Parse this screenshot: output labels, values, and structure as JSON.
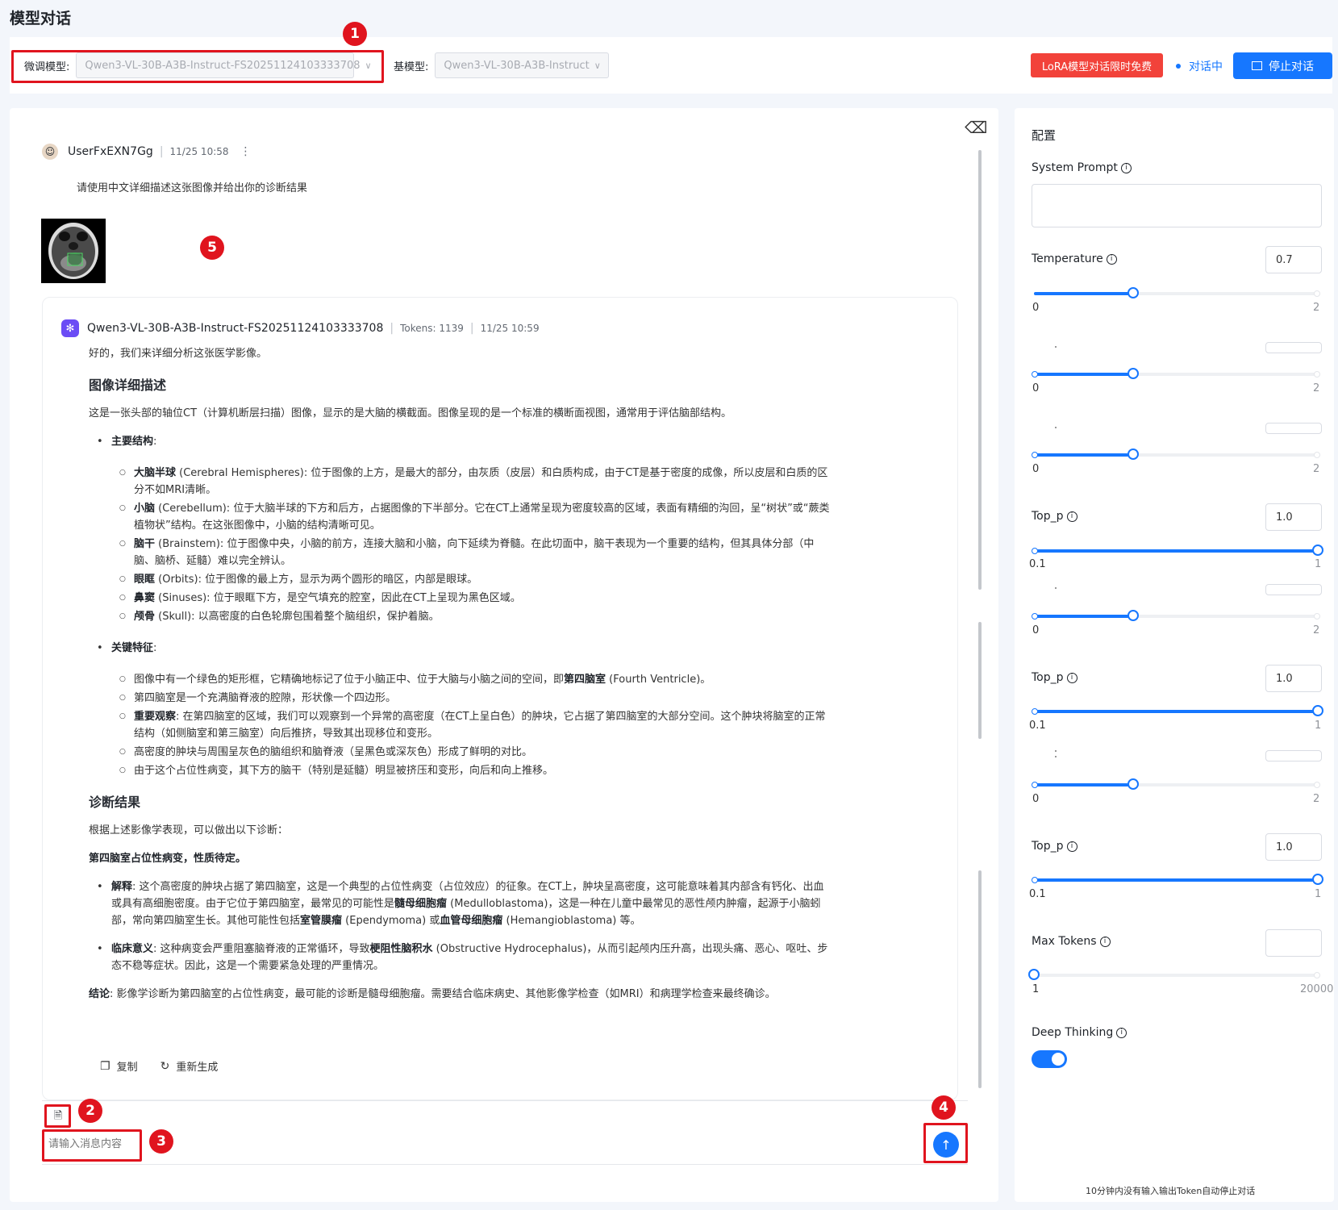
{
  "page": {
    "title": "模型对话"
  },
  "toolbar": {
    "finetune_label": "微调模型:",
    "finetune_value": "Qwen3-VL-30B-A3B-Instruct-FS20251124103333708",
    "base_label": "基模型:",
    "base_value": "Qwen3-VL-30B-A3B-Instruct",
    "lora_badge": "LoRA模型对话限时免费",
    "status": "对话中",
    "stop_label": "停止对话"
  },
  "annotations": [
    "1",
    "2",
    "3",
    "4",
    "5"
  ],
  "user_message": {
    "username": "UserFxEXN7Gg",
    "time": "11/25 10:58",
    "text": "请使用中文详细描述这张图像并给出你的诊断结果"
  },
  "bot_message": {
    "model": "Qwen3-VL-30B-A3B-Instruct-FS20251124103333708",
    "tokens": "Tokens: 1139",
    "time": "11/25 10:59",
    "intro": "好的，我们来详细分析这张医学影像。",
    "h1": "图像详细描述",
    "p1": "这是一张头部的轴位CT（计算机断层扫描）图像，显示的是大脑的横截面。图像呈现的是一个标准的横断面视图，通常用于评估脑部结构。",
    "main_structures_title": "主要结构",
    "main_structures": [
      {
        "term": "大脑半球",
        "text": " (Cerebral Hemispheres): 位于图像的上方，是最大的部分，由灰质（皮层）和白质构成，由于CT是基于密度的成像，所以皮层和白质的区分不如MRI清晰。"
      },
      {
        "term": "小脑",
        "text": " (Cerebellum): 位于大脑半球的下方和后方，占据图像的下半部分。它在CT上通常呈现为密度较高的区域，表面有精细的沟回，呈“树状”或“蕨类植物状”结构。在这张图像中，小脑的结构清晰可见。"
      },
      {
        "term": "脑干",
        "text": " (Brainstem): 位于图像中央，小脑的前方，连接大脑和小脑，向下延续为脊髓。在此切面中，脑干表现为一个重要的结构，但其具体分部（中脑、脑桥、延髓）难以完全辨认。"
      },
      {
        "term": "眼眶",
        "text": " (Orbits): 位于图像的最上方，显示为两个圆形的暗区，内部是眼球。"
      },
      {
        "term": "鼻窦",
        "text": " (Sinuses): 位于眼眶下方，是空气填充的腔室，因此在CT上呈现为黑色区域。"
      },
      {
        "term": "颅骨",
        "text": " (Skull): 以高密度的白色轮廓包围着整个脑组织，保护着脑。"
      }
    ],
    "key_features_title": "关键特征",
    "kf1_pre": "图像中有一个绿色的矩形框，它精确地标记了位于小脑正中、位于大脑与小脑之间的空间，即",
    "kf1_term": "第四脑室",
    "kf1_post": " (Fourth Ventricle)。",
    "kf2": "第四脑室是一个充满脑脊液的腔隙，形状像一个四边形。",
    "kf3_term": "重要观察",
    "kf3": ": 在第四脑室的区域，我们可以观察到一个异常的高密度（在CT上呈白色）的肿块，它占据了第四脑室的大部分空间。这个肿块将脑室的正常结构（如侧脑室和第三脑室）向后推挤，导致其出现移位和变形。",
    "kf4": "高密度的肿块与周围呈灰色的脑组织和脑脊液（呈黑色或深灰色）形成了鲜明的对比。",
    "kf5": "由于这个占位性病变，其下方的脑干（特别是延髓）明显被挤压和变形，向后和向上推移。",
    "h2": "诊断结果",
    "p2": "根据上述影像学表现，可以做出以下诊断：",
    "diagnosis": "第四脑室占位性病变，性质待定。",
    "exp_term": "解释",
    "exp_a": ": 这个高密度的肿块占据了第四脑室，这是一个典型的占位性病变（占位效应）的征象。在CT上，肿块呈高密度，这可能意味着其内部含有钙化、出血或具有高细胞密度。由于它位于第四脑室，最常见的可能性是",
    "exp_t1": "髓母细胞瘤",
    "exp_b": " (Medulloblastoma)，这是一种在儿童中最常见的恶性颅内肿瘤，起源于小脑蚓部，常向第四脑室生长。其他可能性包括",
    "exp_t2": "室管膜瘤",
    "exp_c": " (Ependymoma) 或",
    "exp_t3": "血管母细胞瘤",
    "exp_d": " (Hemangioblastoma) 等。",
    "clin_term": "临床意义",
    "clin_a": ": 这种病变会严重阻塞脑脊液的正常循环，导致",
    "clin_t": "梗阻性脑积水",
    "clin_b": " (Obstructive Hydrocephalus)，从而引起颅内压升高，出现头痛、恶心、呕吐、步态不稳等症状。因此，这是一个需要紧急处理的严重情况。",
    "conc_term": "结论",
    "conc": ": 影像学诊断为第四脑室的占位性病变，最可能的诊断是髓母细胞瘤。需要结合临床病史、其他影像学检查（如MRI）和病理学检查来最终确诊。",
    "copy_label": "复制",
    "regen_label": "重新生成"
  },
  "composer": {
    "placeholder": "请输入消息内容"
  },
  "config": {
    "title": "配置",
    "system_prompt_label": "System Prompt",
    "temperature_label": "Temperature",
    "temperature_value": "0.7",
    "temp_min": "0",
    "temp_max": "2",
    "top_p_label": "Top_p",
    "top_p_value": "1.0",
    "top_p_min": "0.1",
    "top_p_max": "1",
    "max_tokens_label": "Max Tokens",
    "max_tokens_min": "1",
    "max_tokens_max": "20000",
    "deep_thinking_label": "Deep Thinking",
    "deep_thinking_on": true,
    "sliders": {
      "temperature": 0.7,
      "stub_a": 0.7,
      "stub_b": 0.7,
      "top_p_1": 1.0,
      "stub_c": 0.7,
      "top_p_2": 1.0,
      "stub_d": 0.7,
      "top_p_3": 1.0,
      "max_tokens": 1
    },
    "footer_note": "10分钟内没有输入输出Token自动停止对话"
  },
  "colors": {
    "accent": "#1677ff",
    "danger": "#e0141e",
    "lora": "#f2423a"
  }
}
